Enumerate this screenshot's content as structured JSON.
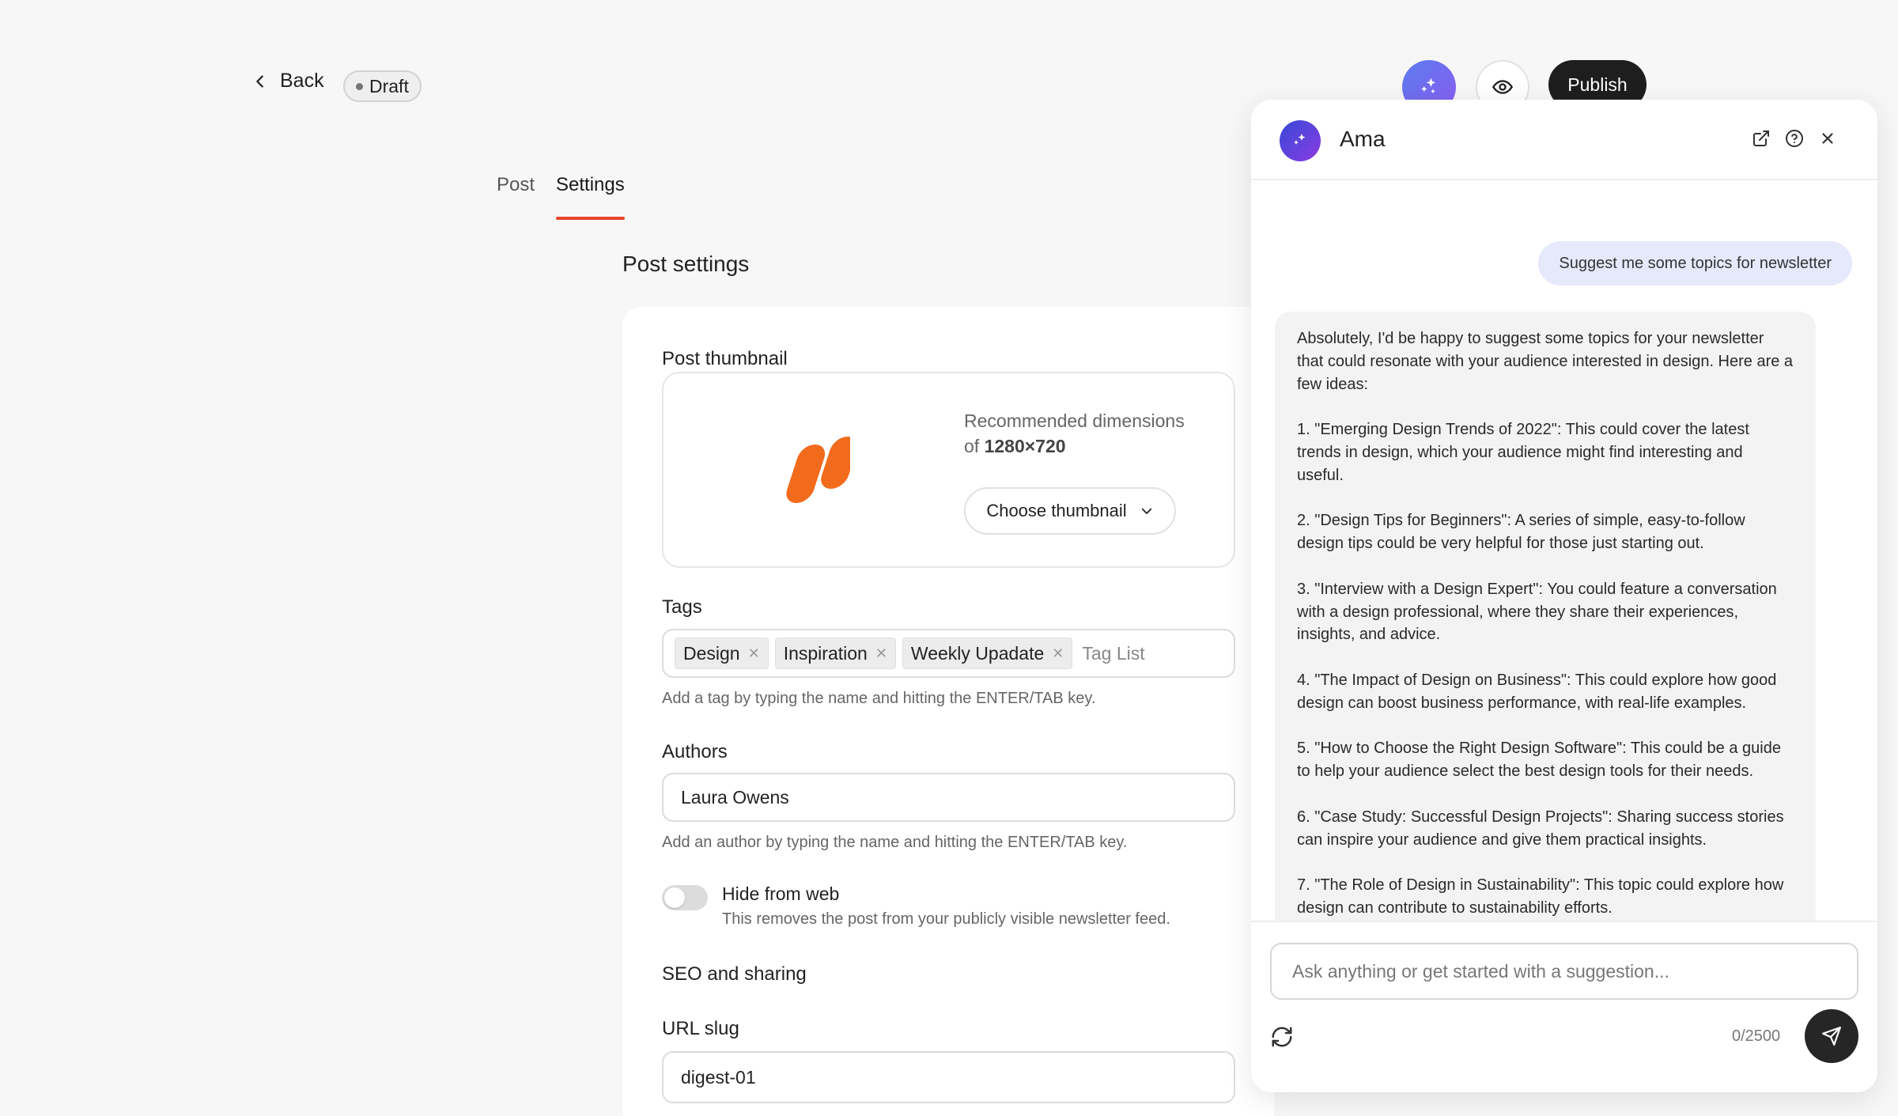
{
  "topbar": {
    "back_label": "Back",
    "status_badge": "Draft",
    "publish_label": "Publish"
  },
  "tabs": [
    {
      "label": "Post",
      "active": false
    },
    {
      "label": "Settings",
      "active": true
    }
  ],
  "settings": {
    "title": "Post settings",
    "thumbnail": {
      "label": "Post thumbnail",
      "recommended_text": "Recommended dimensions of",
      "recommended_size": "1280×720",
      "choose_label": "Choose thumbnail",
      "logo_color": "#f26a1b"
    },
    "tags": {
      "label": "Tags",
      "chips": [
        "Design",
        "Inspiration",
        "Weekly Upadate"
      ],
      "placeholder": "Tag List",
      "help": "Add a tag by typing the name and hitting the ENTER/TAB key."
    },
    "authors": {
      "label": "Authors",
      "value": "Laura Owens",
      "help": "Add an author by typing the name and hitting the ENTER/TAB key."
    },
    "hide_from_web": {
      "title": "Hide from web",
      "description": "This removes the post from your publicly visible newsletter feed.",
      "enabled": false
    },
    "seo": {
      "label": "SEO and sharing",
      "url_slug_label": "URL slug",
      "url_slug_value": "digest-01"
    }
  },
  "chat": {
    "name": "Ama",
    "user_message": "Suggest me some topics for newsletter",
    "ai_paragraphs": [
      "Absolutely, I'd be happy to suggest some topics for your newsletter that could resonate with your audience interested in design. Here are a few ideas:",
      "1. \"Emerging Design Trends of 2022\": This could cover the latest trends in design, which your audience might find interesting and useful.",
      "2. \"Design Tips for Beginners\": A series of simple, easy-to-follow design tips could be very helpful for those just starting out.",
      "3. \"Interview with a Design Expert\": You could feature a conversation with a design professional, where they share their experiences, insights, and advice.",
      "4. \"The Impact of Design on Business\": This could explore how good design can boost business performance, with real-life examples.",
      "5. \"How to Choose the Right Design Software\": This could be a guide to help your audience select the best design tools for their needs.",
      "6. \"Case Study: Successful Design Projects\": Sharing success stories can inspire your audience and give them practical insights.",
      "7. \"The Role of Design in Sustainability\": This topic could explore how design can contribute to sustainability efforts."
    ],
    "input_placeholder": "Ask anything or get started with a suggestion...",
    "counter": "0/2500"
  },
  "colors": {
    "accent_tab_underline": "#e8452c",
    "publish_bg": "#1e1e1e",
    "user_bubble": "#e5e9fb"
  }
}
